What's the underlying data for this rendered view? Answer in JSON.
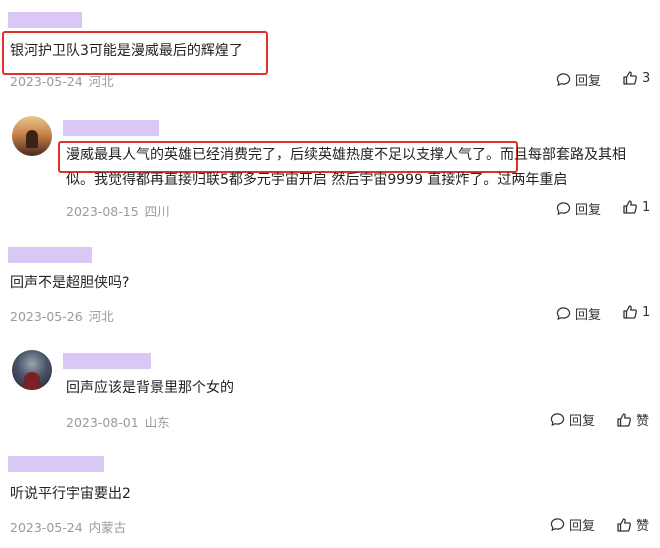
{
  "comments": [
    {
      "text": "银河护卫队3可能是漫威最后的辉煌了",
      "date": "2023-05-24",
      "location": "河北",
      "reply_label": "回复",
      "like_count": "3"
    },
    {
      "text_line1_highlight": "漫威最具人气的英雄已经消费完了，后续英雄热度不足以支撑人气了。",
      "text_line1_rest": "而且每部套路及其相",
      "text_line2": "似。我觉得都再直接归联5都多元宇宙开启 然后宇宙9999 直接炸了。过两年重启",
      "date": "2023-08-15",
      "location": "四川",
      "reply_label": "回复",
      "like_count": "1"
    },
    {
      "text": "回声不是超胆侠吗?",
      "date": "2023-05-26",
      "location": "河北",
      "reply_label": "回复",
      "like_count": "1"
    },
    {
      "text": "回声应该是背景里那个女的",
      "date": "2023-08-01",
      "location": "山东",
      "reply_label": "回复",
      "like_label": "赞"
    },
    {
      "text": "听说平行宇宙要出2",
      "date": "2023-05-24",
      "location": "内蒙古",
      "reply_label": "回复",
      "like_label": "赞"
    }
  ],
  "colors": {
    "name_placeholder": "#d9c8f5",
    "highlight_border": "#e0302e",
    "meta_text": "#9a9a9a"
  },
  "icons": {
    "reply": "comment-bubble-icon",
    "like": "thumbs-up-icon"
  }
}
